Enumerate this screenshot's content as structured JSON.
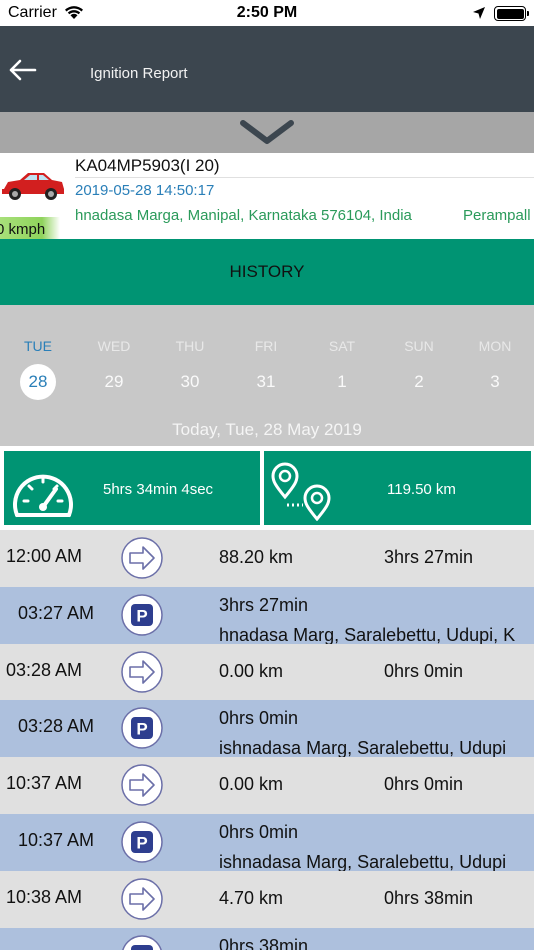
{
  "status_bar": {
    "carrier": "Carrier",
    "time": "2:50 PM"
  },
  "header": {
    "title": "Ignition Report"
  },
  "vehicle": {
    "plate": "KA04MP5903(I 20)",
    "datetime": "2019-05-28 14:50:17",
    "address": "hnadasa Marga, Manipal, Karnataka 576104, India",
    "address_next": "Perampall",
    "speed": "0 kmph"
  },
  "history_button": "HISTORY",
  "calendar": {
    "days": [
      {
        "name": "TUE",
        "date": "28",
        "selected": true
      },
      {
        "name": "WED",
        "date": "29",
        "selected": false
      },
      {
        "name": "THU",
        "date": "30",
        "selected": false
      },
      {
        "name": "FRI",
        "date": "31",
        "selected": false
      },
      {
        "name": "SAT",
        "date": "1",
        "selected": false
      },
      {
        "name": "SUN",
        "date": "2",
        "selected": false
      },
      {
        "name": "MON",
        "date": "3",
        "selected": false
      }
    ],
    "today_label": "Today, Tue, 28 May 2019"
  },
  "summary": {
    "duration": "5hrs 34min 4sec",
    "distance": "119.50 km"
  },
  "rows": [
    {
      "type": "move",
      "time": "12:00 AM",
      "distance": "88.20 km",
      "duration": "3hrs 27min"
    },
    {
      "type": "park",
      "time": "03:27 AM",
      "duration": "3hrs 27min",
      "address": "hnadasa Marg, Saralebettu, Udupi, K"
    },
    {
      "type": "move",
      "time": "03:28 AM",
      "distance": "0.00 km",
      "duration": "0hrs 0min"
    },
    {
      "type": "park",
      "time": "03:28 AM",
      "duration": "0hrs 0min",
      "address": "ishnadasa Marg, Saralebettu, Udupi"
    },
    {
      "type": "move",
      "time": "10:37 AM",
      "distance": "0.00 km",
      "duration": "0hrs 0min"
    },
    {
      "type": "park",
      "time": "10:37 AM",
      "duration": "0hrs 0min",
      "address": "ishnadasa Marg, Saralebettu, Udupi"
    },
    {
      "type": "move",
      "time": "10:38 AM",
      "distance": "4.70 km",
      "duration": "0hrs 38min"
    },
    {
      "type": "park",
      "time": "",
      "duration": "0hrs 38min",
      "address": ""
    }
  ],
  "colors": {
    "header_bg": "#3c464f",
    "accent_green": "#009473",
    "move_row": "#e0e0e0",
    "park_row": "#adc0dd",
    "date_blue": "#2a7fb8"
  },
  "icons": {
    "back": "arrow-left-icon",
    "collapse": "chevron-down-icon",
    "speedometer": "speedometer-icon",
    "route": "route-pins-icon",
    "move": "arrow-right-circle-icon",
    "park": "parking-icon"
  }
}
